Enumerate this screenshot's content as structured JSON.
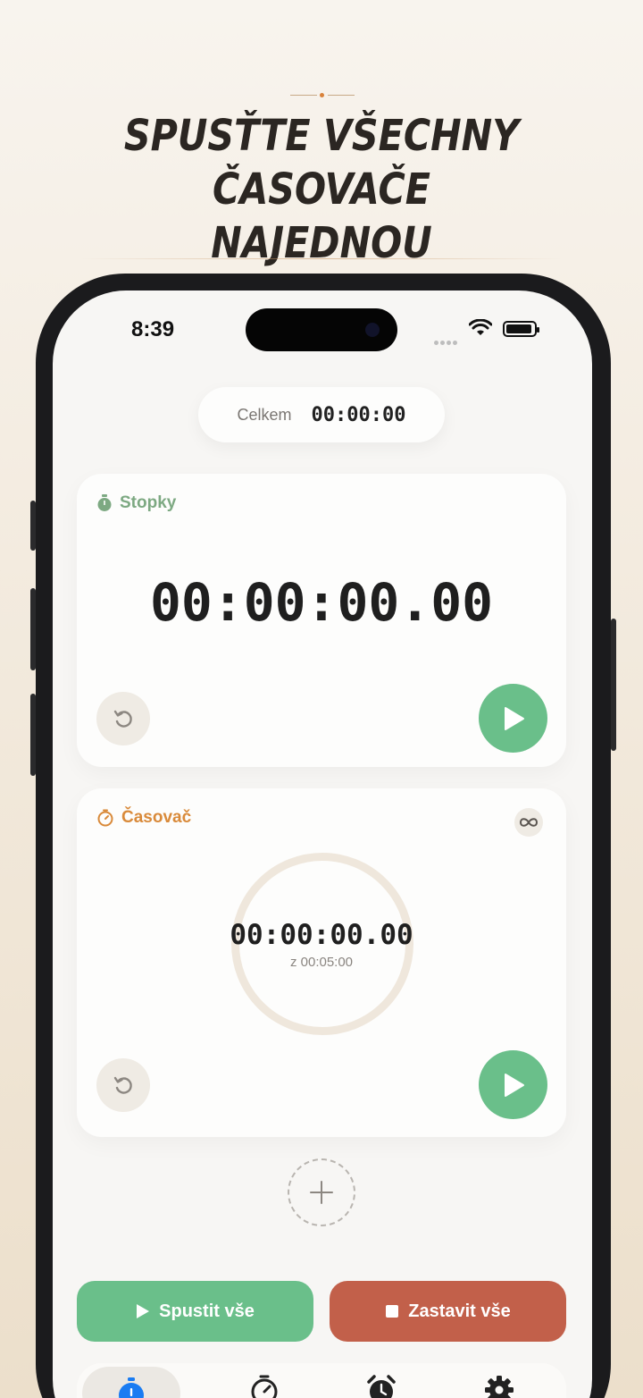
{
  "headline": {
    "line1": "SPUSŤTE VŠECHNY ČASOVAČE",
    "line2": "NAJEDNOU"
  },
  "status_bar": {
    "time": "8:39"
  },
  "total": {
    "label": "Celkem",
    "value": "00:00:00"
  },
  "stopwatch_card": {
    "title": "Stopky",
    "title_color": "#7da982",
    "icon": "stopwatch-icon",
    "time": "00:00:00.00"
  },
  "timer_card": {
    "title": "Časovač",
    "title_color": "#d98a3a",
    "icon": "timer-icon",
    "time": "00:00:00.00",
    "total_label": "z 00:05:00",
    "repeat_icon": "infinity-icon"
  },
  "actions": {
    "start_all": "Spustit vše",
    "stop_all": "Zastavit vše"
  },
  "tabs": [
    {
      "icon": "stopwatch-icon",
      "active": true
    },
    {
      "icon": "timer-icon",
      "active": false
    },
    {
      "icon": "alarm-clock-icon",
      "active": false
    },
    {
      "icon": "gear-icon",
      "active": false
    }
  ],
  "colors": {
    "accent_green": "#6abf8a",
    "accent_red": "#c2604a",
    "tab_active_blue": "#1a7cf2"
  }
}
